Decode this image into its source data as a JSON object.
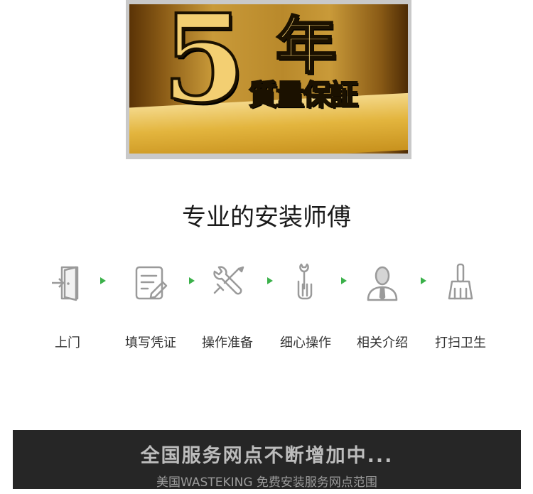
{
  "warranty": {
    "number": "5",
    "year": "年",
    "guarantee": "質量保証"
  },
  "installation": {
    "title": "专业的安装师傅",
    "steps": [
      {
        "icon": "door-enter-icon",
        "label": "上门"
      },
      {
        "icon": "form-edit-icon",
        "label": "填写凭证"
      },
      {
        "icon": "tools-icon",
        "label": "操作准备"
      },
      {
        "icon": "hand-install-icon",
        "label": "细心操作"
      },
      {
        "icon": "technician-icon",
        "label": "相关介绍"
      },
      {
        "icon": "broom-icon",
        "label": "打扫卫生"
      }
    ],
    "arrow_color": "#3bb14a",
    "icon_color": "#9a9a9a"
  },
  "service_banner": {
    "headline": "全国服务网点不断增加中...",
    "subline": "美国WASTEKING 免费安装服务网点范围"
  }
}
